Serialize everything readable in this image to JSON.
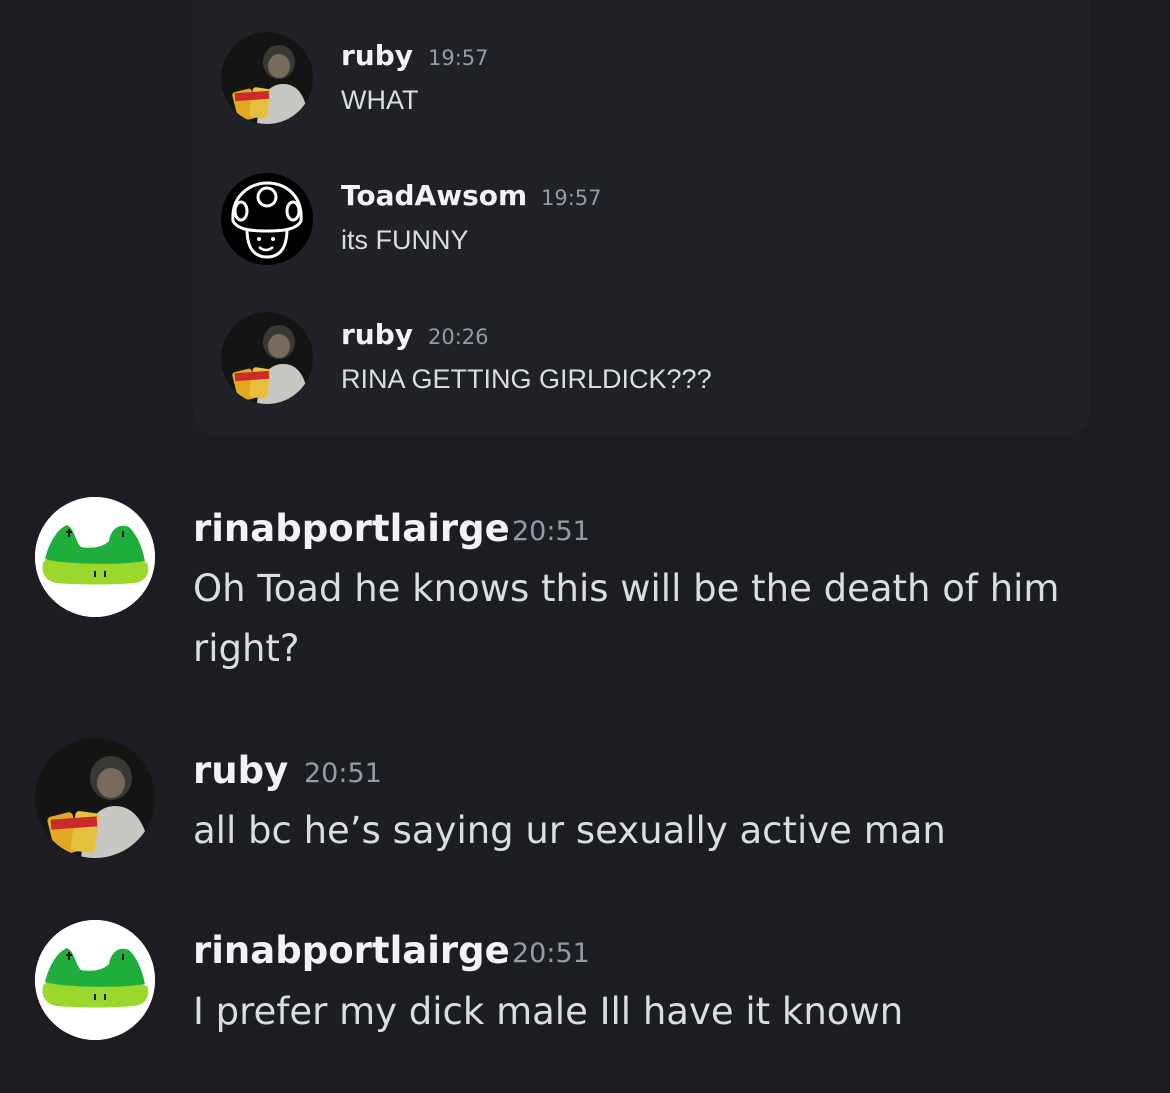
{
  "quoted": [
    {
      "author": "ruby",
      "time": "19:57",
      "text": "WHAT",
      "avatar": "photo-avatar"
    },
    {
      "author": "ToadAwsom",
      "time": "19:57",
      "text": "its FUNNY",
      "avatar": "toad-avatar"
    },
    {
      "author": "ruby",
      "time": "20:26",
      "text": "RINA GETTING GIRLDICK???",
      "avatar": "photo-avatar"
    }
  ],
  "messages": [
    {
      "author": "rinabportlairge",
      "time": "20:51",
      "text_line1": "Oh Toad he knows this will be the death of him",
      "text_line2": "right?",
      "avatar": "frog-avatar"
    },
    {
      "author": "ruby",
      "time": "20:51",
      "text_line1": "all bc he’s saying ur sexually active man",
      "avatar": "photo-avatar"
    },
    {
      "author": "rinabportlairge",
      "time": "20:51",
      "text_line1": "I prefer my dick male Ill have it known",
      "avatar": "frog-avatar"
    }
  ],
  "colors": {
    "background": "#1c1d22",
    "quote_background": "#202127",
    "username": "#f2f3f5",
    "timestamp": "#949ba4",
    "message_text": "#dbdee1"
  }
}
